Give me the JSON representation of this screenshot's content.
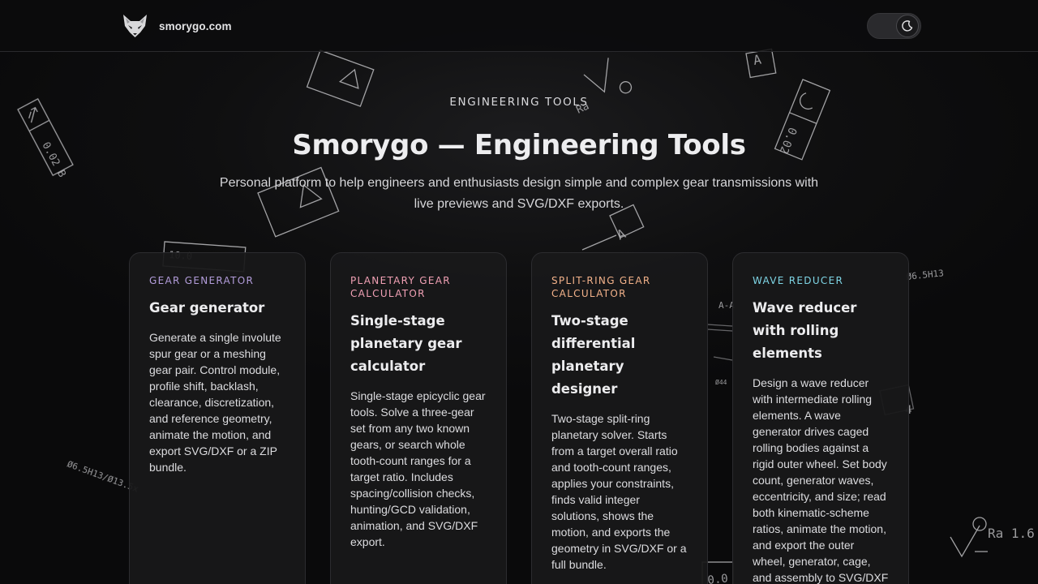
{
  "site": {
    "name": "smorygo.com",
    "logo_icon": "fox-head-icon",
    "theme_toggle_icon": "moon-icon"
  },
  "hero": {
    "eyebrow": "ENGINEERING TOOLS",
    "title": "Smorygo — Engineering Tools",
    "subtitle": "Personal platform to help engineers and enthusiasts design simple and complex gear transmissions with live previews and SVG/DXF exports."
  },
  "cards": [
    {
      "tag": "GEAR GENERATOR",
      "tag_color": "#b39ddb",
      "title": "Gear generator",
      "description": "Generate a single involute spur gear or a meshing gear pair. Control module, profile shift, backlash, clearance, discretization, and reference geometry, animate the motion, and export SVG/DXF or a ZIP bundle."
    },
    {
      "tag": "PLANETARY GEAR CALCULATOR",
      "tag_color": "#f0a0b4",
      "title": "Single-stage planetary gear calculator",
      "description": "Single-stage epicyclic gear tools. Solve a three-gear set from any two known gears, or search whole tooth-count ranges for a target ratio. Includes spacing/collision checks, hunting/GCD validation, animation, and SVG/DXF export."
    },
    {
      "tag": "SPLIT-RING GEAR CALCULATOR",
      "tag_color": "#f3b28a",
      "title": "Two-stage differential planetary designer",
      "description": "Two-stage split-ring planetary solver. Starts from a target overall ratio and tooth-count ranges, applies your constraints, finds valid integer solutions, shows the motion, and exports the geometry in SVG/DXF or a full bundle."
    },
    {
      "tag": "WAVE REDUCER",
      "tag_color": "#7fd6e6",
      "title": "Wave reducer with rolling elements",
      "description": "Design a wave reducer with intermediate rolling elements. A wave generator drives caged rolling bodies against a rigid outer wheel. Set body count, generator waves, eccentricity, and size; read both kinematic-scheme ratios, animate the motion, and export the outer wheel, generator, cage, and assembly to SVG/DXF or a ZIP bundle."
    }
  ]
}
